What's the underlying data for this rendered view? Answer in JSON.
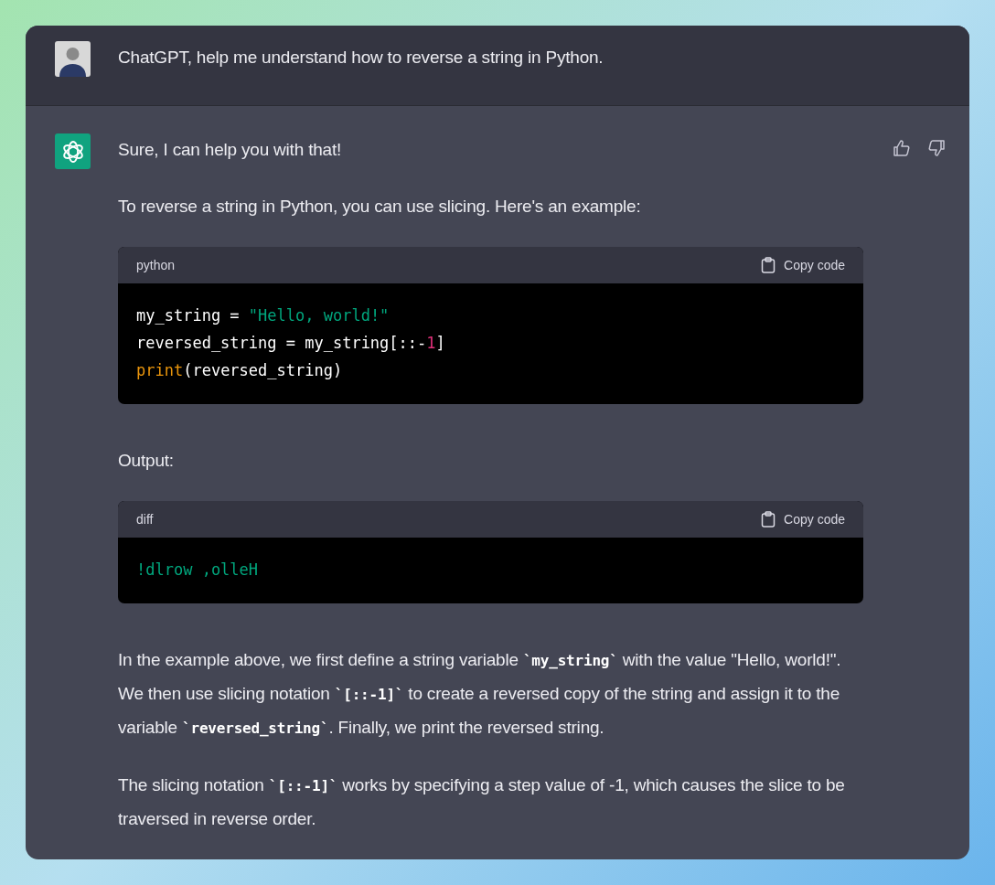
{
  "user_message": {
    "text": "ChatGPT, help me understand how to reverse a string in Python."
  },
  "assistant_message": {
    "blocks": [
      {
        "kind": "paragraph",
        "segments": [
          {
            "kind": "text",
            "text": "Sure, I can help you with that!"
          }
        ]
      },
      {
        "kind": "paragraph",
        "segments": [
          {
            "kind": "text",
            "text": "To reverse a string in Python, you can use slicing. Here's an example:"
          }
        ]
      },
      {
        "kind": "code",
        "language": "python",
        "copy_label": "Copy code",
        "lines": [
          [
            {
              "kind": "plain",
              "text": "my_string = "
            },
            {
              "kind": "string",
              "text": "\"Hello, world!\""
            }
          ],
          [
            {
              "kind": "plain",
              "text": "reversed_string = my_string[::-"
            },
            {
              "kind": "number",
              "text": "1"
            },
            {
              "kind": "plain",
              "text": "]"
            }
          ],
          [
            {
              "kind": "builtin",
              "text": "print"
            },
            {
              "kind": "plain",
              "text": "(reversed_string)"
            }
          ]
        ]
      },
      {
        "kind": "paragraph",
        "segments": [
          {
            "kind": "text",
            "text": "Output:"
          }
        ]
      },
      {
        "kind": "code",
        "language": "diff",
        "copy_label": "Copy code",
        "lines": [
          [
            {
              "kind": "string",
              "text": "!dlrow ,olleH"
            }
          ]
        ]
      },
      {
        "kind": "paragraph",
        "segments": [
          {
            "kind": "text",
            "text": "In the example above, we first define a string variable "
          },
          {
            "kind": "code",
            "text": "`my_string`"
          },
          {
            "kind": "text",
            "text": " with the value \"Hello, world!\". We then use slicing notation "
          },
          {
            "kind": "code",
            "text": "`[::-1]`"
          },
          {
            "kind": "text",
            "text": " to create a reversed copy of the string and assign it to the variable "
          },
          {
            "kind": "code",
            "text": "`reversed_string`"
          },
          {
            "kind": "text",
            "text": ". Finally, we print the reversed string."
          }
        ]
      },
      {
        "kind": "paragraph",
        "segments": [
          {
            "kind": "text",
            "text": "The slicing notation "
          },
          {
            "kind": "code",
            "text": "`[::-1]`"
          },
          {
            "kind": "text",
            "text": " works by specifying a step value of -1, which causes the slice to be traversed in reverse order."
          }
        ]
      }
    ]
  }
}
